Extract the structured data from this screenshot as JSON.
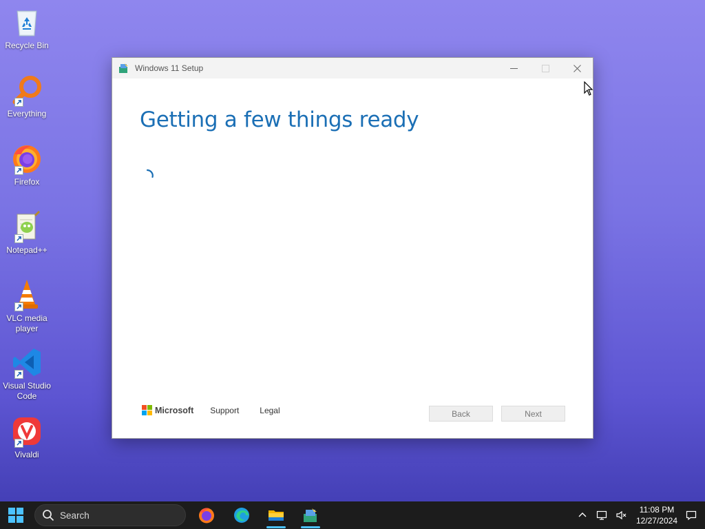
{
  "desktop": {
    "icons": [
      {
        "label": "Recycle Bin",
        "icon": "recycle-bin-icon"
      },
      {
        "label": "Everything",
        "icon": "everything-search-icon"
      },
      {
        "label": "Firefox",
        "icon": "firefox-icon"
      },
      {
        "label": "Notepad++",
        "icon": "notepad-plus-plus-icon"
      },
      {
        "label": "VLC media player",
        "icon": "vlc-icon"
      },
      {
        "label": "Visual Studio Code",
        "icon": "vscode-icon"
      },
      {
        "label": "Vivaldi",
        "icon": "vivaldi-icon"
      }
    ]
  },
  "window": {
    "title": "Windows 11 Setup",
    "heading": "Getting a few things ready",
    "footer": {
      "brand": "Microsoft",
      "support": "Support",
      "legal": "Legal"
    },
    "buttons": {
      "back": "Back",
      "next": "Next"
    }
  },
  "taskbar": {
    "search_placeholder": "Search",
    "apps": [
      "firefox-icon",
      "edge-icon",
      "file-explorer-icon",
      "setup-icon"
    ],
    "time": "11:08 PM",
    "date": "12/27/2024"
  },
  "colors": {
    "accent": "#1b6fb5",
    "taskbar": "#1c1c1c",
    "indicator": "#4cc2ff"
  }
}
